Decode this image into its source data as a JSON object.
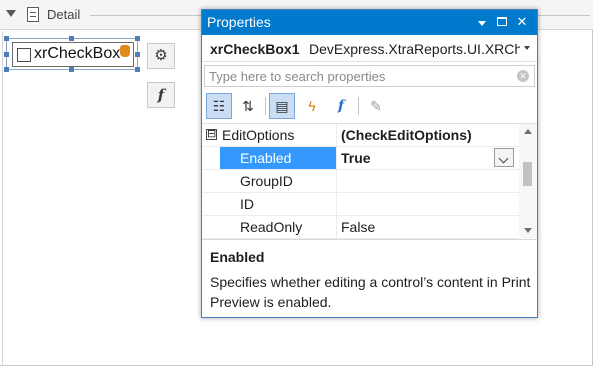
{
  "designer": {
    "band_title": "Detail",
    "control_text": "xrCheckBox"
  },
  "properties": {
    "window_title": "Properties",
    "object_name": "xrCheckBox1",
    "object_type": "DevExpress.XtraReports.UI.XRCheckBox",
    "search_placeholder": "Type here to search properties",
    "toolbar": [
      "categorized-view-icon",
      "alphabetical-sort-icon",
      "properties-tab-icon",
      "events-icon",
      "expressions-icon",
      "wrench-icon"
    ],
    "rows": [
      {
        "name": "EditOptions",
        "value": "(CheckEditOptions)",
        "type": "category",
        "expander": "⊟"
      },
      {
        "name": "Enabled",
        "value": "True",
        "type": "selected"
      },
      {
        "name": "GroupID",
        "value": ""
      },
      {
        "name": "ID",
        "value": ""
      },
      {
        "name": "ReadOnly",
        "value": "False"
      }
    ],
    "description": {
      "title": "Enabled",
      "text": "Specifies whether editing a control’s content in Print Preview is enabled."
    }
  },
  "colors": {
    "title_bar": "#007acc",
    "selection": "#3399ff"
  }
}
